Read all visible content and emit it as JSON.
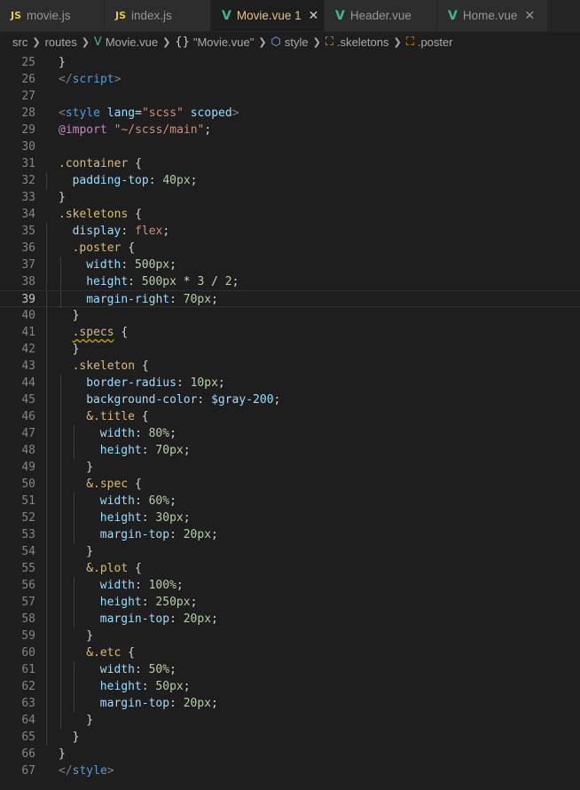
{
  "tabs": [
    {
      "icon": "js-icon",
      "icon_text": "JS",
      "label": "movie.js",
      "active": false
    },
    {
      "icon": "js-icon",
      "icon_text": "JS",
      "label": "index.js",
      "active": false
    },
    {
      "icon": "vue-icon",
      "icon_text": "V",
      "label": "Movie.vue 1",
      "active": true
    },
    {
      "icon": "vue-icon",
      "icon_text": "V",
      "label": "Header.vue",
      "active": false
    },
    {
      "icon": "vue-icon",
      "icon_text": "V",
      "label": "Home.vue",
      "active": false
    }
  ],
  "breadcrumb": {
    "folder1": "src",
    "folder2": "routes",
    "file": "Movie.vue",
    "block": "\"Movie.vue\"",
    "style": "style",
    "sel1": ".skeletons",
    "sel2": ".poster"
  },
  "editor": {
    "current_line": 39,
    "lines": [
      {
        "n": 25,
        "indent": 0,
        "tokens": [
          [
            "txt",
            "}"
          ]
        ]
      },
      {
        "n": 26,
        "indent": 0,
        "tokens": [
          [
            "tag",
            "</"
          ],
          [
            "tn",
            "script"
          ],
          [
            "tag",
            ">"
          ]
        ]
      },
      {
        "n": 27,
        "indent": 0,
        "tokens": []
      },
      {
        "n": 28,
        "indent": 0,
        "tokens": [
          [
            "tag",
            "<"
          ],
          [
            "tn",
            "style"
          ],
          [
            "txt",
            " "
          ],
          [
            "attr",
            "lang"
          ],
          [
            "txt",
            "="
          ],
          [
            "str",
            "\"scss\""
          ],
          [
            "txt",
            " "
          ],
          [
            "attr",
            "scoped"
          ],
          [
            "tag",
            ">"
          ]
        ]
      },
      {
        "n": 29,
        "indent": 0,
        "tokens": [
          [
            "at",
            "@import"
          ],
          [
            "txt",
            " "
          ],
          [
            "str",
            "\"~/scss/main\""
          ],
          [
            "txt",
            ";"
          ]
        ]
      },
      {
        "n": 30,
        "indent": 0,
        "tokens": []
      },
      {
        "n": 31,
        "indent": 0,
        "tokens": [
          [
            "sel",
            ".container"
          ],
          [
            "txt",
            " {"
          ]
        ]
      },
      {
        "n": 32,
        "indent": 1,
        "tokens": [
          [
            "prop",
            "padding-top"
          ],
          [
            "txt",
            ": "
          ],
          [
            "num",
            "40px"
          ],
          [
            "txt",
            ";"
          ]
        ]
      },
      {
        "n": 33,
        "indent": 0,
        "tokens": [
          [
            "txt",
            "}"
          ]
        ]
      },
      {
        "n": 34,
        "indent": 0,
        "tokens": [
          [
            "sel",
            ".skeletons"
          ],
          [
            "txt",
            " {"
          ]
        ]
      },
      {
        "n": 35,
        "indent": 1,
        "tokens": [
          [
            "prop",
            "display"
          ],
          [
            "txt",
            ": "
          ],
          [
            "val",
            "flex"
          ],
          [
            "txt",
            ";"
          ]
        ]
      },
      {
        "n": 36,
        "indent": 1,
        "tokens": [
          [
            "sel",
            ".poster"
          ],
          [
            "txt",
            " {"
          ]
        ]
      },
      {
        "n": 37,
        "indent": 2,
        "tokens": [
          [
            "prop",
            "width"
          ],
          [
            "txt",
            ": "
          ],
          [
            "num",
            "500px"
          ],
          [
            "txt",
            ";"
          ]
        ]
      },
      {
        "n": 38,
        "indent": 2,
        "tokens": [
          [
            "prop",
            "height"
          ],
          [
            "txt",
            ": "
          ],
          [
            "num",
            "500px"
          ],
          [
            "txt",
            " * "
          ],
          [
            "num",
            "3"
          ],
          [
            "txt",
            " / "
          ],
          [
            "num",
            "2"
          ],
          [
            "txt",
            ";"
          ]
        ]
      },
      {
        "n": 39,
        "indent": 2,
        "tokens": [
          [
            "prop",
            "margin-right"
          ],
          [
            "txt",
            ": "
          ],
          [
            "num",
            "70px"
          ],
          [
            "txt",
            ";"
          ]
        ]
      },
      {
        "n": 40,
        "indent": 1,
        "tokens": [
          [
            "txt",
            "}"
          ]
        ]
      },
      {
        "n": 41,
        "indent": 1,
        "tokens": [
          [
            "selsq",
            ".specs"
          ],
          [
            "txt",
            " {"
          ]
        ]
      },
      {
        "n": 42,
        "indent": 1,
        "tokens": [
          [
            "txt",
            "}"
          ]
        ]
      },
      {
        "n": 43,
        "indent": 1,
        "tokens": [
          [
            "sel",
            ".skeleton"
          ],
          [
            "txt",
            " {"
          ]
        ]
      },
      {
        "n": 44,
        "indent": 2,
        "tokens": [
          [
            "prop",
            "border-radius"
          ],
          [
            "txt",
            ": "
          ],
          [
            "num",
            "10px"
          ],
          [
            "txt",
            ";"
          ]
        ]
      },
      {
        "n": 45,
        "indent": 2,
        "tokens": [
          [
            "prop",
            "background-color"
          ],
          [
            "txt",
            ": "
          ],
          [
            "var",
            "$gray-200"
          ],
          [
            "txt",
            ";"
          ]
        ]
      },
      {
        "n": 46,
        "indent": 2,
        "tokens": [
          [
            "sel",
            "&.title"
          ],
          [
            "txt",
            " {"
          ]
        ]
      },
      {
        "n": 47,
        "indent": 3,
        "tokens": [
          [
            "prop",
            "width"
          ],
          [
            "txt",
            ": "
          ],
          [
            "num",
            "80%"
          ],
          [
            "txt",
            ";"
          ]
        ]
      },
      {
        "n": 48,
        "indent": 3,
        "tokens": [
          [
            "prop",
            "height"
          ],
          [
            "txt",
            ": "
          ],
          [
            "num",
            "70px"
          ],
          [
            "txt",
            ";"
          ]
        ]
      },
      {
        "n": 49,
        "indent": 2,
        "tokens": [
          [
            "txt",
            "}"
          ]
        ]
      },
      {
        "n": 50,
        "indent": 2,
        "tokens": [
          [
            "sel",
            "&.spec"
          ],
          [
            "txt",
            " {"
          ]
        ]
      },
      {
        "n": 51,
        "indent": 3,
        "tokens": [
          [
            "prop",
            "width"
          ],
          [
            "txt",
            ": "
          ],
          [
            "num",
            "60%"
          ],
          [
            "txt",
            ";"
          ]
        ]
      },
      {
        "n": 52,
        "indent": 3,
        "tokens": [
          [
            "prop",
            "height"
          ],
          [
            "txt",
            ": "
          ],
          [
            "num",
            "30px"
          ],
          [
            "txt",
            ";"
          ]
        ]
      },
      {
        "n": 53,
        "indent": 3,
        "tokens": [
          [
            "prop",
            "margin-top"
          ],
          [
            "txt",
            ": "
          ],
          [
            "num",
            "20px"
          ],
          [
            "txt",
            ";"
          ]
        ]
      },
      {
        "n": 54,
        "indent": 2,
        "tokens": [
          [
            "txt",
            "}"
          ]
        ]
      },
      {
        "n": 55,
        "indent": 2,
        "tokens": [
          [
            "sel",
            "&.plot"
          ],
          [
            "txt",
            " {"
          ]
        ]
      },
      {
        "n": 56,
        "indent": 3,
        "tokens": [
          [
            "prop",
            "width"
          ],
          [
            "txt",
            ": "
          ],
          [
            "num",
            "100%"
          ],
          [
            "txt",
            ";"
          ]
        ]
      },
      {
        "n": 57,
        "indent": 3,
        "tokens": [
          [
            "prop",
            "height"
          ],
          [
            "txt",
            ": "
          ],
          [
            "num",
            "250px"
          ],
          [
            "txt",
            ";"
          ]
        ]
      },
      {
        "n": 58,
        "indent": 3,
        "tokens": [
          [
            "prop",
            "margin-top"
          ],
          [
            "txt",
            ": "
          ],
          [
            "num",
            "20px"
          ],
          [
            "txt",
            ";"
          ]
        ]
      },
      {
        "n": 59,
        "indent": 2,
        "tokens": [
          [
            "txt",
            "}"
          ]
        ]
      },
      {
        "n": 60,
        "indent": 2,
        "tokens": [
          [
            "sel",
            "&.etc"
          ],
          [
            "txt",
            " {"
          ]
        ]
      },
      {
        "n": 61,
        "indent": 3,
        "tokens": [
          [
            "prop",
            "width"
          ],
          [
            "txt",
            ": "
          ],
          [
            "num",
            "50%"
          ],
          [
            "txt",
            ";"
          ]
        ]
      },
      {
        "n": 62,
        "indent": 3,
        "tokens": [
          [
            "prop",
            "height"
          ],
          [
            "txt",
            ": "
          ],
          [
            "num",
            "50px"
          ],
          [
            "txt",
            ";"
          ]
        ]
      },
      {
        "n": 63,
        "indent": 3,
        "tokens": [
          [
            "prop",
            "margin-top"
          ],
          [
            "txt",
            ": "
          ],
          [
            "num",
            "20px"
          ],
          [
            "txt",
            ";"
          ]
        ]
      },
      {
        "n": 64,
        "indent": 2,
        "tokens": [
          [
            "txt",
            "}"
          ]
        ]
      },
      {
        "n": 65,
        "indent": 1,
        "tokens": [
          [
            "txt",
            "}"
          ]
        ]
      },
      {
        "n": 66,
        "indent": 0,
        "tokens": [
          [
            "txt",
            "}"
          ]
        ]
      },
      {
        "n": 67,
        "indent": 0,
        "tokens": [
          [
            "tag",
            "</"
          ],
          [
            "tn",
            "style"
          ],
          [
            "tag",
            ">"
          ]
        ]
      }
    ]
  }
}
